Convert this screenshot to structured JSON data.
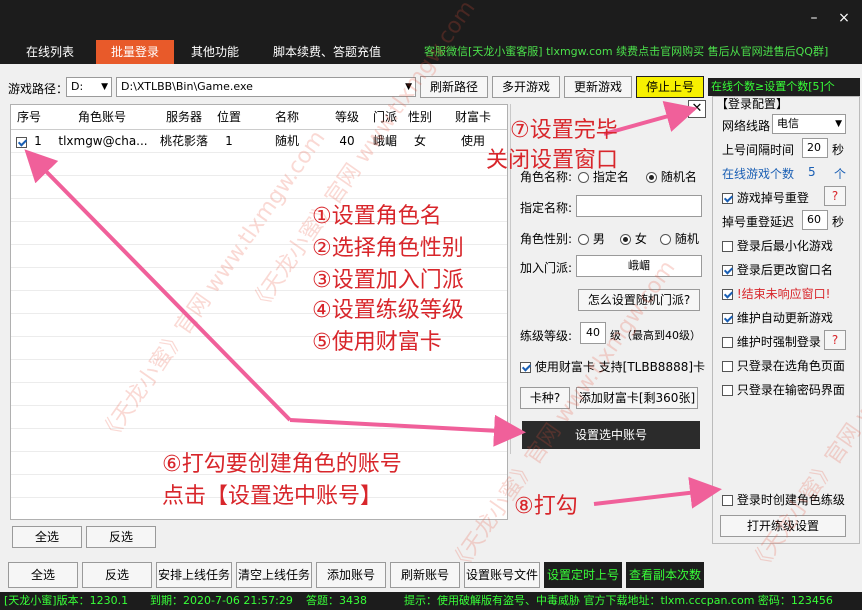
{
  "window": {
    "minimize": "–",
    "close": "×"
  },
  "tabs": [
    {
      "label": "在线列表",
      "active": false
    },
    {
      "label": "批量登录",
      "active": true
    },
    {
      "label": "其他功能",
      "active": false
    },
    {
      "label": "脚本续费、答题充值",
      "active": false
    }
  ],
  "notice": "客服微信[天龙小蜜客服] tlxmgw.com 续费点击官网购买 售后从官网进售后QQ群]",
  "toolbar": {
    "path_label": "游戏路径：",
    "drive_value": "D:",
    "path_value": "D:\\XTLBB\\Bin\\Game.exe",
    "refresh_path": "刷新路径",
    "multi_open": "多开游戏",
    "update_game": "更新游戏",
    "stop_login": "停止上号",
    "online_status": "在线个数≥设置个数[5]个"
  },
  "table": {
    "columns": [
      "序号",
      "角色账号",
      "服务器",
      "位置",
      "名称",
      "等级",
      "门派",
      "性别",
      "财富卡"
    ],
    "rows": [
      {
        "checked": true,
        "index": "1",
        "account": "tlxmgw@cha...",
        "server": "桃花影落",
        "position": "1",
        "name": "随机",
        "level": "40",
        "sect": "峨嵋",
        "gender": "女",
        "wealth": "使用"
      }
    ]
  },
  "config_panel": {
    "role_name_label": "角色名称:",
    "role_name_opt1": "指定名",
    "role_name_opt2": "随机名",
    "specified_name_label": "指定名称:",
    "specified_name_value": "",
    "gender_label": "角色性别:",
    "gender_male": "男",
    "gender_female": "女",
    "gender_random": "随机",
    "join_sect_label": "加入门派:",
    "join_sect_value": "峨嵋",
    "random_sect_btn": "怎么设置随机门派?",
    "level_label": "练级等级:",
    "level_value": "40",
    "level_suffix": "级（最高到40级）",
    "use_wealth": "使用财富卡  支持[TLBB8888]卡",
    "card_type_btn": "卡种?",
    "add_card_btn": "添加财富卡[剩360张]",
    "set_selected_btn": "设置选中账号",
    "close": "✕"
  },
  "right_panel": {
    "title": "【登录配置】",
    "line_label": "网络线路",
    "line_value": "电信",
    "interval_label": "上号间隔时间",
    "interval_value": "20",
    "interval_unit": "秒",
    "online_label": "在线游戏个数",
    "online_value": "5",
    "online_unit": "个",
    "reconnect": "游戏掉号重登",
    "help1": "?",
    "reconnect_delay_label": "掉号重登延迟",
    "reconnect_delay_value": "60",
    "reconnect_delay_unit": "秒",
    "minimize_after": "登录后最小化游戏",
    "rename_after": "登录后更改窗口名",
    "kill_unresponsive": "!结束未响应窗口!",
    "auto_update": "维护自动更新游戏",
    "force_login": "维护时强制登录",
    "help2": "?",
    "only_select_role": "只登录在选角色页面",
    "only_password": "只登录在输密码界面",
    "create_on_login": "登录时创建角色练级",
    "open_level_btn": "打开练级设置"
  },
  "bottom_buttons": {
    "select_all_small": "全选",
    "invert_small": "反选",
    "select_all": "全选",
    "invert": "反选",
    "schedule_online": "安排上线任务",
    "clear_online": "清空上线任务",
    "add_account": "添加账号",
    "refresh_account": "刷新账号",
    "set_account_file": "设置账号文件",
    "timed_login": "设置定时上号",
    "check_instances": "查看副本次数"
  },
  "status_bar": {
    "version": "[天龙小蜜]版本：1230.1",
    "expire": "到期：2020-7-06 21:57:29",
    "answers": "答题：3438",
    "tip": "提示：使用破解版有盗号、中毒威胁 官方下载地址：tlxm.cccpan.com 密码：123456"
  },
  "annotations": {
    "step7a": "⑦设置完毕",
    "step7b": "关闭设置窗口",
    "step1": "①设置角色名",
    "step2": "②选择角色性别",
    "step3": "③设置加入门派",
    "step4": "④设置练级等级",
    "step5": "⑤使用财富卡",
    "step6a": "⑥打勾要创建角色的账号",
    "step6b": "点击【设置选中账号】",
    "step8": "⑧打勾"
  },
  "watermark": "《天龙小蜜》官网 www.tlxmgw.com",
  "colors": {
    "accent": "#e85a2a",
    "annotation": "#d8262b",
    "arrow": "#f0609a",
    "green": "#38ff38"
  }
}
